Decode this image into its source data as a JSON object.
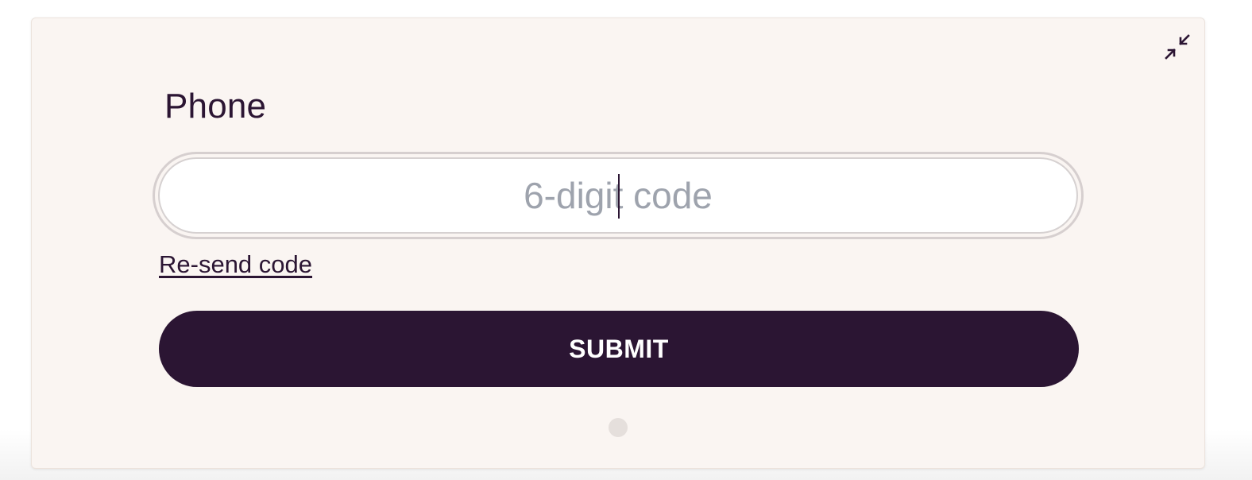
{
  "form": {
    "title": "Phone",
    "code_input": {
      "placeholder": "6-digit code",
      "value": ""
    },
    "resend_label": "Re-send code",
    "submit_label": "SUBMIT",
    "pagination": {
      "current": 1,
      "total": 1
    }
  },
  "icons": {
    "collapse": "collapse-icon"
  },
  "colors": {
    "accent": "#2b1533",
    "card_background": "#faf5f2",
    "placeholder": "#9ea3ad"
  }
}
